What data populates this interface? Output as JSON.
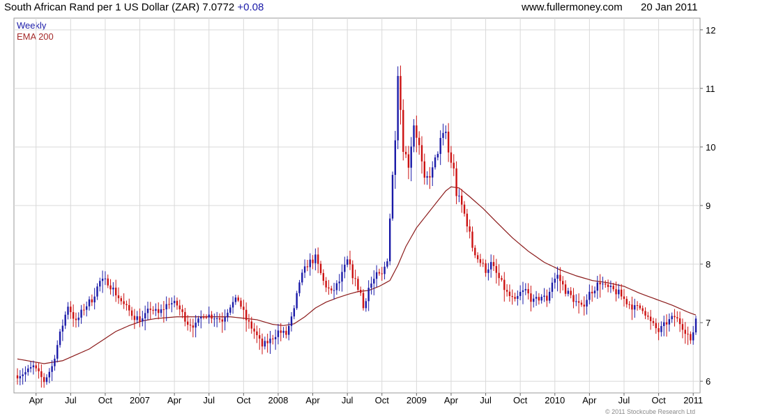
{
  "header": {
    "title": "South African Rand per 1 US Dollar (ZAR) 7.0772",
    "change": "+0.08",
    "site": "www.fullermoney.com",
    "date": "20 Jan 2011"
  },
  "copyright": "© 2011 Stockcube Research Ltd",
  "chart_data": {
    "type": "candlestick",
    "legend": [
      "Weekly",
      "EMA 200"
    ],
    "colors": {
      "up": "#1a1aa8",
      "down": "#cc1111",
      "ema": "#8b1a1a",
      "grid": "#d9d9d9"
    },
    "ylim": [
      5.8,
      12.2
    ],
    "yticks": [
      6,
      7,
      8,
      9,
      10,
      11,
      12
    ],
    "x_axis_labels": [
      "Apr",
      "Jul",
      "Oct",
      "2007",
      "Apr",
      "Jul",
      "Oct",
      "2008",
      "Apr",
      "Jul",
      "Oct",
      "2009",
      "Apr",
      "Jul",
      "Oct",
      "2010",
      "Apr",
      "Jul",
      "Oct",
      "2011"
    ],
    "week_range": [
      0,
      255
    ],
    "x_label_weeks": [
      7,
      20,
      33,
      46,
      59,
      72,
      85,
      98,
      111,
      124,
      137,
      150,
      163,
      176,
      189,
      202,
      215,
      228,
      241,
      254
    ],
    "close_anchors": [
      [
        0,
        6.1
      ],
      [
        3,
        6.15
      ],
      [
        6,
        6.25
      ],
      [
        10,
        6.0
      ],
      [
        13,
        6.25
      ],
      [
        16,
        6.8
      ],
      [
        19,
        7.3
      ],
      [
        22,
        7.0
      ],
      [
        25,
        7.25
      ],
      [
        28,
        7.4
      ],
      [
        31,
        7.7
      ],
      [
        34,
        7.7
      ],
      [
        37,
        7.5
      ],
      [
        40,
        7.3
      ],
      [
        44,
        7.1
      ],
      [
        47,
        7.05
      ],
      [
        50,
        7.25
      ],
      [
        53,
        7.15
      ],
      [
        57,
        7.35
      ],
      [
        60,
        7.3
      ],
      [
        64,
        7.0
      ],
      [
        67,
        6.95
      ],
      [
        70,
        7.15
      ],
      [
        74,
        7.1
      ],
      [
        77,
        7.05
      ],
      [
        80,
        7.3
      ],
      [
        83,
        7.4
      ],
      [
        86,
        7.05
      ],
      [
        89,
        6.85
      ],
      [
        92,
        6.6
      ],
      [
        95,
        6.7
      ],
      [
        98,
        6.85
      ],
      [
        101,
        6.8
      ],
      [
        104,
        7.2
      ],
      [
        106,
        7.7
      ],
      [
        109,
        8.0
      ],
      [
        112,
        8.1
      ],
      [
        115,
        7.7
      ],
      [
        118,
        7.5
      ],
      [
        121,
        7.7
      ],
      [
        124,
        8.05
      ],
      [
        127,
        7.7
      ],
      [
        129,
        7.5
      ],
      [
        130,
        7.25
      ],
      [
        132,
        7.6
      ],
      [
        135,
        7.8
      ],
      [
        137,
        7.8
      ],
      [
        139,
        8.1
      ],
      [
        141,
        9.5
      ],
      [
        142,
        10.2
      ],
      [
        143,
        11.3
      ],
      [
        145,
        10.0
      ],
      [
        147,
        9.7
      ],
      [
        149,
        10.4
      ],
      [
        151,
        10.0
      ],
      [
        153,
        9.4
      ],
      [
        156,
        9.6
      ],
      [
        159,
        10.1
      ],
      [
        161,
        10.25
      ],
      [
        162,
        9.9
      ],
      [
        164,
        9.6
      ],
      [
        165,
        9.2
      ],
      [
        167,
        9.0
      ],
      [
        169,
        8.7
      ],
      [
        171,
        8.3
      ],
      [
        173,
        8.1
      ],
      [
        176,
        7.9
      ],
      [
        178,
        8.0
      ],
      [
        181,
        7.75
      ],
      [
        184,
        7.5
      ],
      [
        187,
        7.35
      ],
      [
        189,
        7.5
      ],
      [
        191,
        7.55
      ],
      [
        194,
        7.35
      ],
      [
        197,
        7.45
      ],
      [
        199,
        7.4
      ],
      [
        201,
        7.7
      ],
      [
        203,
        7.8
      ],
      [
        206,
        7.55
      ],
      [
        209,
        7.4
      ],
      [
        212,
        7.25
      ],
      [
        215,
        7.5
      ],
      [
        217,
        7.6
      ],
      [
        219,
        7.7
      ],
      [
        221,
        7.6
      ],
      [
        224,
        7.55
      ],
      [
        226,
        7.5
      ],
      [
        229,
        7.35
      ],
      [
        232,
        7.25
      ],
      [
        235,
        7.25
      ],
      [
        238,
        7.0
      ],
      [
        241,
        6.85
      ],
      [
        244,
        7.0
      ],
      [
        247,
        7.1
      ],
      [
        249,
        7.0
      ],
      [
        252,
        6.8
      ],
      [
        253,
        6.65
      ],
      [
        254,
        6.85
      ],
      [
        255,
        7.08
      ]
    ],
    "ema_anchors": [
      [
        0,
        6.38
      ],
      [
        10,
        6.3
      ],
      [
        17,
        6.35
      ],
      [
        22,
        6.45
      ],
      [
        27,
        6.55
      ],
      [
        32,
        6.7
      ],
      [
        37,
        6.85
      ],
      [
        42,
        6.95
      ],
      [
        47,
        7.03
      ],
      [
        52,
        7.07
      ],
      [
        60,
        7.1
      ],
      [
        70,
        7.1
      ],
      [
        80,
        7.1
      ],
      [
        90,
        7.05
      ],
      [
        96,
        6.97
      ],
      [
        100,
        6.95
      ],
      [
        104,
        6.98
      ],
      [
        108,
        7.1
      ],
      [
        112,
        7.25
      ],
      [
        116,
        7.35
      ],
      [
        120,
        7.42
      ],
      [
        124,
        7.48
      ],
      [
        128,
        7.53
      ],
      [
        132,
        7.55
      ],
      [
        136,
        7.62
      ],
      [
        140,
        7.72
      ],
      [
        143,
        7.98
      ],
      [
        146,
        8.3
      ],
      [
        150,
        8.62
      ],
      [
        154,
        8.85
      ],
      [
        158,
        9.08
      ],
      [
        161,
        9.25
      ],
      [
        163,
        9.32
      ],
      [
        166,
        9.3
      ],
      [
        170,
        9.15
      ],
      [
        175,
        8.95
      ],
      [
        180,
        8.72
      ],
      [
        186,
        8.45
      ],
      [
        192,
        8.22
      ],
      [
        198,
        8.03
      ],
      [
        204,
        7.9
      ],
      [
        210,
        7.8
      ],
      [
        216,
        7.72
      ],
      [
        222,
        7.68
      ],
      [
        228,
        7.62
      ],
      [
        234,
        7.5
      ],
      [
        240,
        7.4
      ],
      [
        246,
        7.3
      ],
      [
        252,
        7.18
      ],
      [
        255,
        7.13
      ]
    ]
  }
}
